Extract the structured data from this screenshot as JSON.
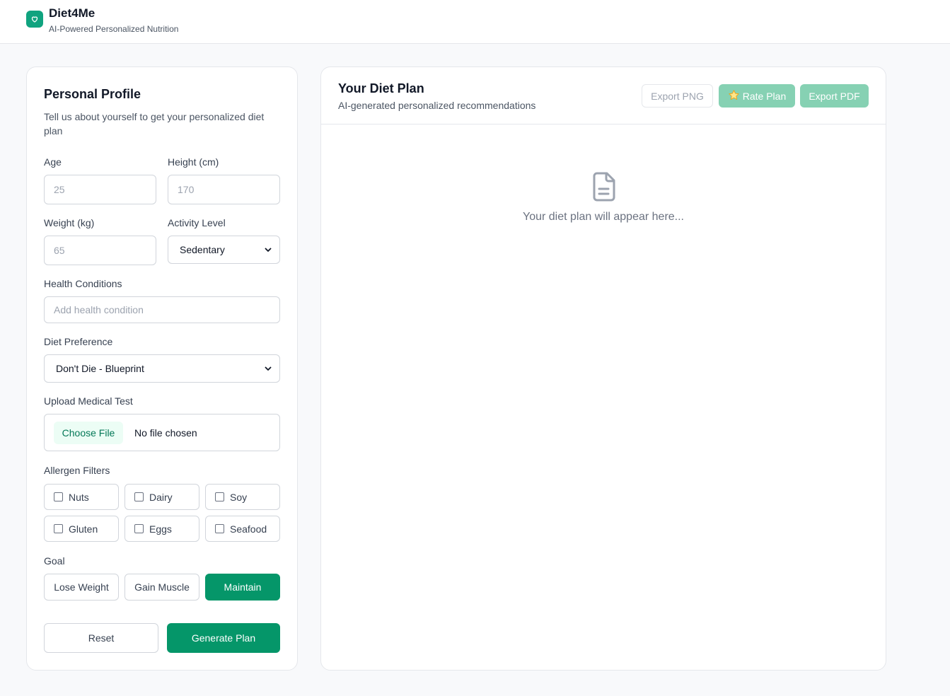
{
  "header": {
    "brand": "Diet4Me",
    "tagline": "AI-Powered Personalized Nutrition",
    "logo_icon": "heart-icon",
    "accent_color": "#10a37f"
  },
  "profile": {
    "title": "Personal Profile",
    "description": "Tell us about yourself to get your personalized diet plan",
    "age": {
      "label": "Age",
      "value": "",
      "placeholder": "25"
    },
    "height": {
      "label": "Height (cm)",
      "value": "",
      "placeholder": "170"
    },
    "weight": {
      "label": "Weight (kg)",
      "value": "",
      "placeholder": "65"
    },
    "activity": {
      "label": "Activity Level",
      "selected": "Sedentary"
    },
    "health": {
      "label": "Health Conditions",
      "placeholder": "Add health condition"
    },
    "diet": {
      "label": "Diet Preference",
      "selected": "Don't Die - Blueprint"
    },
    "upload": {
      "label": "Upload Medical Test",
      "button": "Choose File",
      "status": "No file chosen"
    },
    "allergens": {
      "label": "Allergen Filters",
      "items": [
        {
          "label": "Nuts",
          "checked": false
        },
        {
          "label": "Dairy",
          "checked": false
        },
        {
          "label": "Soy",
          "checked": false
        },
        {
          "label": "Gluten",
          "checked": false
        },
        {
          "label": "Eggs",
          "checked": false
        },
        {
          "label": "Seafood",
          "checked": false
        }
      ]
    },
    "goal": {
      "label": "Goal",
      "options": [
        "Lose Weight",
        "Gain Muscle",
        "Maintain"
      ],
      "selected": "Maintain"
    },
    "reset_label": "Reset",
    "generate_label": "Generate Plan"
  },
  "plan": {
    "title": "Your Diet Plan",
    "subtitle": "AI-generated personalized recommendations",
    "export_png": "Export PNG",
    "rate_plan": "Rate Plan",
    "rate_icon": "star-icon",
    "export_pdf": "Export PDF",
    "empty_icon": "document-icon",
    "empty_text": "Your diet plan will appear here..."
  }
}
